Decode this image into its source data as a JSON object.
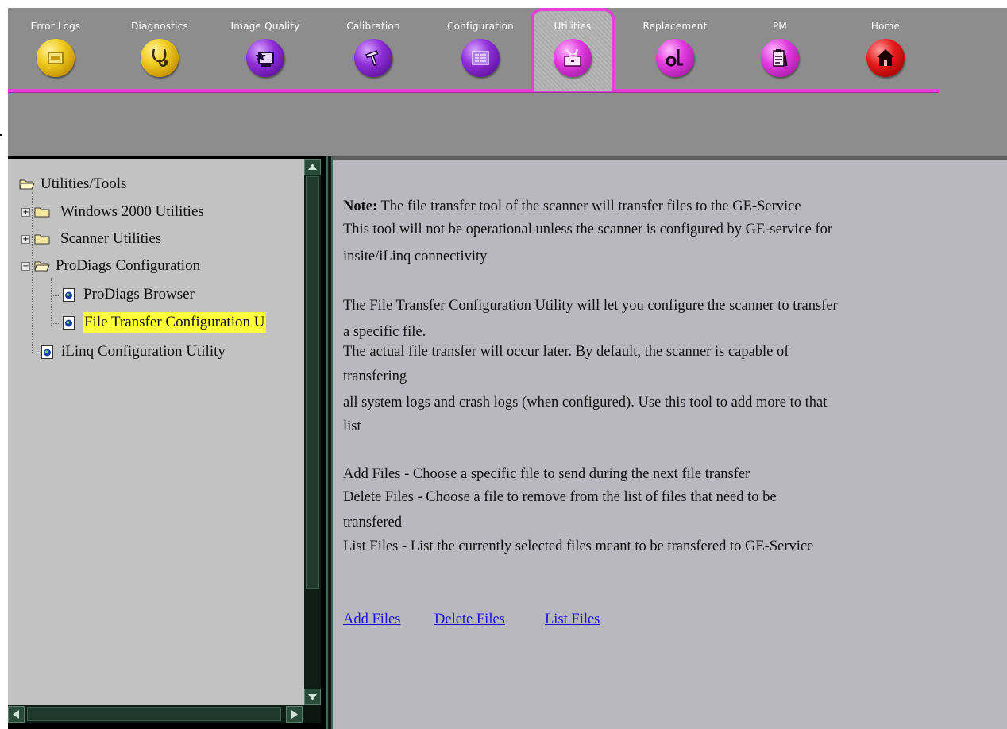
{
  "tabs": [
    {
      "label": "Error Logs",
      "icon": "error-logs-icon",
      "color": "yellow",
      "active": false
    },
    {
      "label": "Diagnostics",
      "icon": "stethoscope-icon",
      "color": "yellow",
      "active": false
    },
    {
      "label": "Image Quality",
      "icon": "image-quality-icon",
      "color": "purple",
      "active": false
    },
    {
      "label": "Calibration",
      "icon": "calibration-tools-icon",
      "color": "purple",
      "active": false
    },
    {
      "label": "Configuration",
      "icon": "configuration-list-icon",
      "color": "purple",
      "active": false
    },
    {
      "label": "Utilities",
      "icon": "utilities-toolbox-icon",
      "color": "magenta",
      "active": true
    },
    {
      "label": "Replacement",
      "icon": "replacement-icon",
      "color": "magenta",
      "active": false
    },
    {
      "label": "PM",
      "icon": "pm-checklist-icon",
      "color": "magenta",
      "active": false
    },
    {
      "label": "Home",
      "icon": "home-icon",
      "color": "red",
      "active": false
    }
  ],
  "colors": {
    "accent_magenta": "#e43fd6",
    "topbar_bg": "#8d8d8d",
    "content_bg": "#b9b8be",
    "tree_bg": "#c2c2c2",
    "selection": "#ffff3a",
    "link": "#1b10d8"
  },
  "tree": {
    "root": "Utilities/Tools",
    "items": [
      {
        "label": "Windows 2000 Utilities",
        "type": "folder",
        "expander": "+"
      },
      {
        "label": "Scanner Utilities",
        "type": "folder",
        "expander": "+"
      },
      {
        "label": "ProDiags Configuration",
        "type": "folder-open",
        "expander": "−"
      },
      {
        "label": "ProDiags Browser",
        "type": "page"
      },
      {
        "label": "File Transfer Configuration U",
        "type": "page",
        "selected": true
      },
      {
        "label": "iLinq Configuration Utility",
        "type": "page"
      }
    ]
  },
  "content": {
    "note_label": "Note:",
    "note_line1": " The file transfer tool of the scanner will transfer files to the GE-Service",
    "line2": "This tool will not be operational unless the scanner is configured by GE-service for",
    "line3": "insite/iLinq connectivity",
    "line4": "The File Transfer Configuration Utility will let you configure the scanner to transfer",
    "line5": "a specific file.",
    "line6": "The actual file transfer will occur later. By default, the scanner is capable of",
    "line7": "transfering",
    "line8": "all system logs and crash logs (when configured). Use this tool to add more to that",
    "line9": "list",
    "line10": "Add Files - Choose a specific file to send during the next file transfer",
    "line11": "Delete Files - Choose a file to remove from the list of files that need to be",
    "line12": "transfered",
    "line13": "List Files - List the currently selected files meant to be transfered to GE-Service"
  },
  "links": {
    "add": "Add Files ",
    "delete": "Delete Files ",
    "list": "List Files "
  }
}
